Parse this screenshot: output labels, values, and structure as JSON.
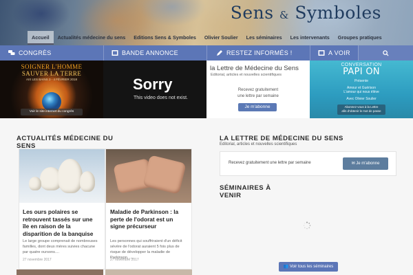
{
  "header": {
    "site_title_part1": "Sens",
    "site_title_amp": "&",
    "site_title_part2": "Symboles"
  },
  "nav": {
    "items": [
      {
        "label": "Accueil",
        "active": true
      },
      {
        "label": "Actualités médecine du sens"
      },
      {
        "label": "Editions Sens & Symboles"
      },
      {
        "label": "Olivier Soulier"
      },
      {
        "label": "Les séminaires"
      },
      {
        "label": "Les intervenants"
      },
      {
        "label": "Groupes pratiques"
      }
    ]
  },
  "tabs": {
    "congres": {
      "label": "Congrès",
      "icon": "chat-bubbles-icon"
    },
    "bande_annonce": {
      "label": "Bande annonce",
      "icon": "film-icon"
    },
    "restez_informes": {
      "label": "Restez informés !",
      "icon": "pen-icon"
    },
    "a_voir": {
      "label": "A voir",
      "icon": "film-icon"
    },
    "search": {
      "icon": "search-icon"
    }
  },
  "panels": {
    "congres": {
      "line1": "SOIGNER L'HOMME",
      "line2": "SAUVER LA TERRE",
      "line3": "AIX LES BAINS   3 - 4   FÉVRIER 2018",
      "button": "Voir le site internet du congrès"
    },
    "video": {
      "title": "Sorry",
      "message": "This video does not exist."
    },
    "lettre": {
      "title": "la Lettre de Médecine du Sens",
      "subtitle": "Editorial, articles et nouvelles scientifiques",
      "text1": "Recevez gratuitement",
      "text2": "une lettre par semaine",
      "button": "Je m'abonne"
    },
    "papillon": {
      "line1": "CONVERSATION",
      "line2": "PAPI ON",
      "line3": "Présente",
      "line4": "Amour et Guérison",
      "line5": "L'amour qui nous élève",
      "line6": "Avec Olivier Soulier",
      "button_line1": "Abonnez-vous à la Lettre",
      "button_line2": "afin d'obtenir le mot de passe"
    }
  },
  "actualites": {
    "title": "Actualités médecine du sens",
    "articles": [
      {
        "title": "Les ours polaires se retrouvent tassés sur une île en raison de la disparition de la banquise",
        "excerpt": "Le large groupe comprenait de nombreuses familles, dont deux mères suivies chacune par quatre oursons....",
        "date": "27 novembre 2017"
      },
      {
        "title": "Maladie de Parkinson : la perte de l'odorat est un signe précurseur",
        "excerpt": "Les personnes qui souffriraient d'un déficit sévère de l'odorat auraient 5 fois plus de risque de développer la maladie de Parkinson. ....",
        "date": "27 novembre 2017"
      }
    ]
  },
  "lettre_section": {
    "title": "La lettre de médecine du sens",
    "subtitle": "Editorial, articles et nouvelles scientifiques",
    "newsletter_text": "Recevez gratuitement une lettre par semaine",
    "button": "Je m'abonne",
    "button_icon": "envelope-icon"
  },
  "seminaires": {
    "title": "Séminaires à venir",
    "button": "Voir tous les séminaires",
    "button_icon": "group-icon"
  },
  "colors": {
    "tab_bar": "#5c76b7",
    "button_blue": "#5d7d9e"
  }
}
